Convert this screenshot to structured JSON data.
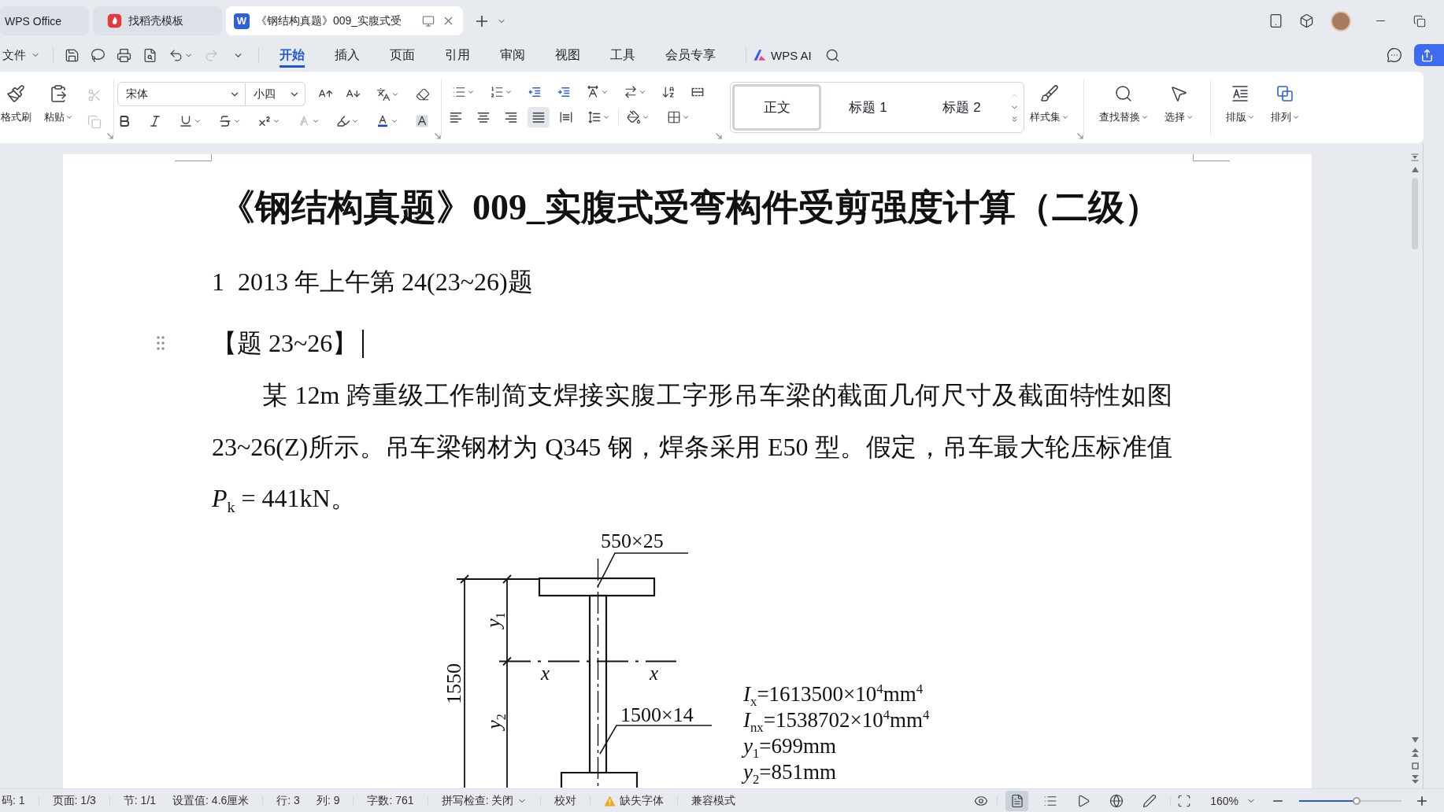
{
  "window": {
    "tabs": [
      {
        "kind": "home",
        "label": "WPS Office",
        "selected": false
      },
      {
        "kind": "template",
        "label": "找稻壳模板",
        "selected": false
      },
      {
        "kind": "document",
        "label": "《钢结构真题》009_实腹式受",
        "badge": "W",
        "selected": true
      }
    ]
  },
  "menu": {
    "file": "文件",
    "quick_access": [
      {
        "kind": "save",
        "disabled": false
      },
      {
        "kind": "export",
        "disabled": false
      },
      {
        "kind": "print",
        "disabled": false
      },
      {
        "kind": "preview",
        "disabled": false
      },
      {
        "kind": "undo",
        "disabled": false
      },
      {
        "kind": "redo",
        "disabled": true
      }
    ],
    "tabs": [
      {
        "label": "开始",
        "selected": true
      },
      {
        "label": "插入",
        "selected": false
      },
      {
        "label": "页面",
        "selected": false
      },
      {
        "label": "引用",
        "selected": false
      },
      {
        "label": "审阅",
        "selected": false
      },
      {
        "label": "视图",
        "selected": false
      },
      {
        "label": "工具",
        "selected": false
      },
      {
        "label": "会员专享",
        "selected": false
      }
    ],
    "ai": "WPS AI"
  },
  "ribbon": {
    "format_painter": "格式刷",
    "paste": "粘贴",
    "clipboard": [
      {
        "kind": "cut",
        "disabled": true
      },
      {
        "kind": "copy",
        "disabled": true
      }
    ],
    "font_name": "宋体",
    "font_size": "小四",
    "font_effects": [
      {
        "kind": "bold",
        "disabled": false
      },
      {
        "kind": "italic",
        "disabled": false
      },
      {
        "kind": "underline",
        "disabled": false
      },
      {
        "kind": "strikethrough",
        "disabled": false
      },
      {
        "kind": "superscript",
        "disabled": false
      },
      {
        "kind": "text-effect",
        "disabled": true
      },
      {
        "kind": "highlight",
        "disabled": false
      },
      {
        "kind": "font-color",
        "disabled": false
      },
      {
        "kind": "shading",
        "disabled": false
      }
    ],
    "alignment": [
      {
        "kind": "left",
        "selected": false
      },
      {
        "kind": "center",
        "selected": false
      },
      {
        "kind": "right",
        "selected": false
      },
      {
        "kind": "justify",
        "selected": true
      },
      {
        "kind": "distributed",
        "selected": false
      }
    ],
    "styles": [
      {
        "label": "正文",
        "selected": true
      },
      {
        "label": "标题 1",
        "selected": false
      },
      {
        "label": "标题 2",
        "selected": false
      }
    ],
    "style_set": "样式集",
    "find_replace": "查找替换",
    "select": "选择",
    "layout": "排版",
    "arrange": "排列"
  },
  "document": {
    "title": "《钢结构真题》009_实腹式受弯构件受剪强度计算（二级）",
    "heading": {
      "number": "1",
      "text": "2013 年上午第 24(23~26)题"
    },
    "subheading": "【题 23~26】",
    "paragraph": "某 12m 跨重级工作制简支焊接实腹工字形吊车梁的截面几何尺寸及截面特性如图 23~26(Z)所示。吊车梁钢材为 Q345 钢，焊条采用 E50 型。假定，吊车最大轮压标准值 *P*$_{k}$ = 441kN。",
    "figure": {
      "top_flange_label": "550×25",
      "web_label": "1500×14",
      "height_label": "1550",
      "upper_label": "*y*$_{1}$",
      "lower_label": "*y*$_{2}$",
      "axis_labels": [
        "x",
        "x"
      ],
      "properties": [
        "*I*$_{x}$=1613500×10$^{4}$mm$^{4}$",
        "*I*$_{nx}$=1538702×10$^{4}$mm$^{4}$",
        "*y*$_{1}$=699mm",
        "*y*$_{2}$=851mm"
      ]
    }
  },
  "status_bar": {
    "groups": [
      [
        {
          "kind": "text",
          "label": "码: 1"
        }
      ],
      [
        {
          "kind": "text",
          "label": "页面: 1/3"
        }
      ],
      [
        {
          "kind": "text",
          "label": "节: 1/1"
        },
        {
          "kind": "text",
          "label": "设置值: 4.6厘米"
        }
      ],
      [
        {
          "kind": "text",
          "label": "行: 3"
        },
        {
          "kind": "text",
          "label": "列: 9"
        }
      ],
      [
        {
          "kind": "text",
          "label": "字数: 761"
        }
      ],
      [
        {
          "kind": "dropdown",
          "label": "拼写检查: 关闭"
        }
      ],
      [
        {
          "kind": "text",
          "label": "校对"
        }
      ],
      [
        {
          "kind": "warning",
          "label": "缺失字体"
        }
      ],
      [
        {
          "kind": "text",
          "label": "兼容模式"
        }
      ]
    ],
    "views": [
      {
        "kind": "reading",
        "selected": false
      },
      {
        "kind": "page",
        "selected": true
      },
      {
        "kind": "outline",
        "selected": false
      },
      {
        "kind": "present",
        "selected": false
      },
      {
        "kind": "web",
        "selected": false
      },
      {
        "kind": "pen",
        "selected": false
      }
    ],
    "zoom": {
      "value": "160%",
      "level": 0.56
    }
  }
}
